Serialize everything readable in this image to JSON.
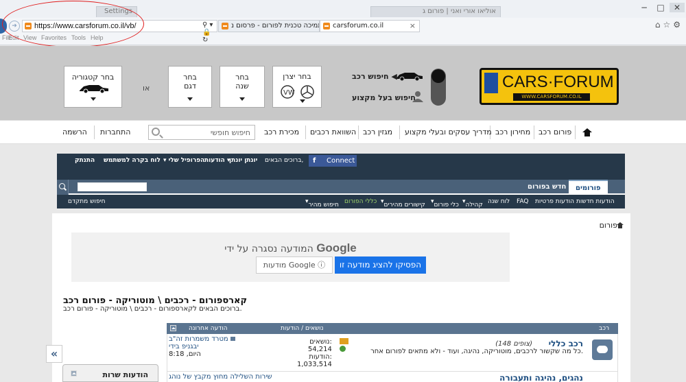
{
  "browser": {
    "tabs_behind": [
      "Settings",
      "אוליאו אורי ואני | פורום ג"
    ],
    "url": "https://www.carsforum.co.il/vb/",
    "tabs": [
      {
        "label": "תמיכה טכנית לפורום - פרסום נ...",
        "active": false
      },
      {
        "label": "carsforum.co.il",
        "active": true
      }
    ],
    "menu": [
      "File",
      "Edit",
      "View",
      "Favorites",
      "Tools",
      "Help"
    ]
  },
  "header": {
    "logo_text": "CARS·FORUM",
    "logo_sub": "WWW.CARSFORUM.CO.IL",
    "search_car": "חיפוש רכב",
    "search_pro": "חיפוש בעל מקצוע",
    "selectors": [
      {
        "lines": [
          "בחר יצרן"
        ]
      },
      {
        "lines": [
          "בחר",
          "שנה"
        ]
      },
      {
        "lines": [
          "בחר",
          "דגם"
        ]
      },
      {
        "lines": [
          "בחר קטגוריה"
        ]
      }
    ],
    "or_label": "או"
  },
  "mainnav": {
    "items": [
      "פורום רכב",
      "מחירון רכב",
      "מדריך עסקים ובעלי מקצוע",
      "מגזין רכב",
      "השוואת רכבים",
      "מכירת רכב"
    ],
    "search_placeholder": "חיפוש חופשי",
    "login": "התחברות",
    "register": "הרשמה"
  },
  "forum_bar": {
    "connect": "Connect",
    "welcome": "ברוכים הבאים,",
    "username": "יונתן יונתן",
    "notifications": "הודעות",
    "profile": "הפרופיל שלי",
    "control_panel": "לוח בקרה למשתמש",
    "logout": "התנתק",
    "tab_forums": "פורומים",
    "tab_whats_new": "חדש בפורום",
    "sub_items": [
      "הודעות חדשות",
      "הודעות פרטיות",
      "FAQ",
      "לוח שנה",
      "קהילה",
      "כלי פורום",
      "קישורים מהירים",
      "כללי הפורום",
      "חיפוש מהיר"
    ],
    "advanced_search": "חיפוש מתקדם"
  },
  "content": {
    "breadcrumb": "פורום",
    "ad": {
      "title": "המודעה נסגרה על ידי",
      "brand": "Google",
      "stop": "הפסיקו להציג מודעה זו",
      "why": "מודעות Google ⓘ"
    },
    "page_title": "קארספורום - רכבים \\ מוטוריקה - פורום רכב",
    "page_desc": "ברוכים הבאים לקארספורום - רכבים \\ מוטוריקה - פורום רכב.",
    "table_headers": {
      "forum": "רכב",
      "threads_posts": "נושאים / הודעות",
      "last_post": "הודעה אחרונה"
    },
    "forums": [
      {
        "name": "רכב כללי",
        "viewers": "(צופים 148)",
        "desc": "כל מה שקשור לרכבים, מוטוריקה, נהיגה, ועוד - ולא מתאים לפורום אחר.",
        "threads_label": "נושאים:",
        "threads": "54,214",
        "posts_label": "הודעות:",
        "posts": "1,033,514",
        "last_title": "מטרד משמרות זה\"ב",
        "last_by": "יבגניפ בידי",
        "last_time": "היום, 8:18"
      }
    ],
    "next_row_partial": "נהגים, נהיגה ותעבורה",
    "next_row_last": "שירות השלילה מחוץ מקבץ של נוהג"
  },
  "sidebar": {
    "toggle": "«",
    "panel_title": "הודעות שרות"
  },
  "colors": {
    "accent": "#263849",
    "tab_bar": "#4a6179",
    "logo_yellow": "#f4c20d",
    "annotation_red": "#e01c1c"
  }
}
